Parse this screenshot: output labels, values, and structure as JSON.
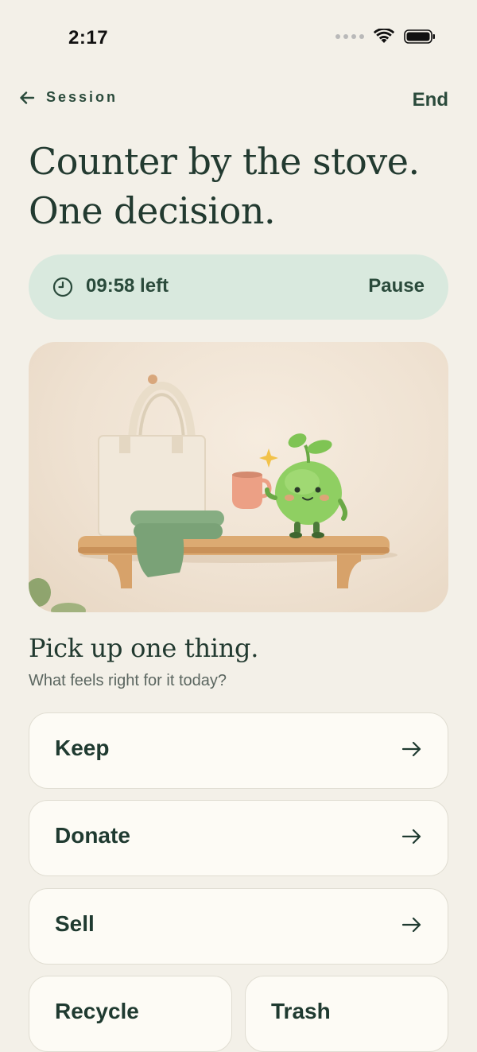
{
  "status": {
    "time": "2:17"
  },
  "nav": {
    "back_label": "Session",
    "end_label": "End"
  },
  "headline": {
    "line1": "Counter by the stove.",
    "line2": "One decision."
  },
  "timer": {
    "text": "09:58 left",
    "pause_label": "Pause"
  },
  "prompt": {
    "title": "Pick up one thing.",
    "subtitle": "What feels right for it today?"
  },
  "options": {
    "keep": "Keep",
    "donate": "Donate",
    "sell": "Sell",
    "recycle": "Recycle",
    "trash": "Trash"
  },
  "colors": {
    "background": "#f3f0e8",
    "accent": "#d9e9de",
    "text": "#1f3a30",
    "card": "#fdfbf5"
  },
  "icons": [
    "back-arrow-icon",
    "clock-icon",
    "arrow-right-icon",
    "wifi-icon",
    "battery-icon",
    "signal-icon"
  ]
}
